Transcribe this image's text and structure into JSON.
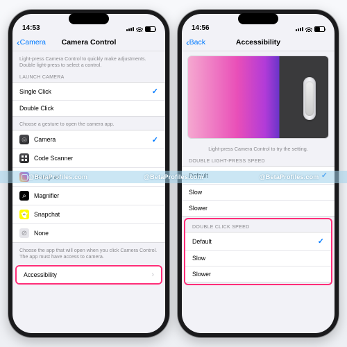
{
  "watermark": "@BetaProfiles.com",
  "left": {
    "status_time": "14:53",
    "nav_back": "Camera",
    "nav_title": "Camera Control",
    "hint_top": "Light-press Camera Control to quickly make adjustments. Double light-press to select a control.",
    "section_launch": "LAUNCH CAMERA",
    "launch_options": {
      "single": "Single Click",
      "double": "Double Click"
    },
    "hint_gesture": "Choose a gesture to open the camera app.",
    "apps": {
      "camera": "Camera",
      "code": "Code Scanner",
      "instagram": "Instagram",
      "magnifier": "Magnifier",
      "snapchat": "Snapchat",
      "none": "None"
    },
    "hint_app": "Choose the app that will open when you click Camera Control. The app must have access to camera.",
    "accessibility_row": "Accessibility"
  },
  "right": {
    "status_time": "14:56",
    "nav_back": "Back",
    "nav_title": "Accessibility",
    "hint_preview": "Light-press Camera Control to try the setting.",
    "section_light": "DOUBLE LIGHT-PRESS SPEED",
    "light_options": {
      "default": "Default",
      "slow": "Slow",
      "slower": "Slower"
    },
    "section_click": "DOUBLE CLICK SPEED",
    "click_options": {
      "default": "Default",
      "slow": "Slow",
      "slower": "Slower"
    }
  }
}
